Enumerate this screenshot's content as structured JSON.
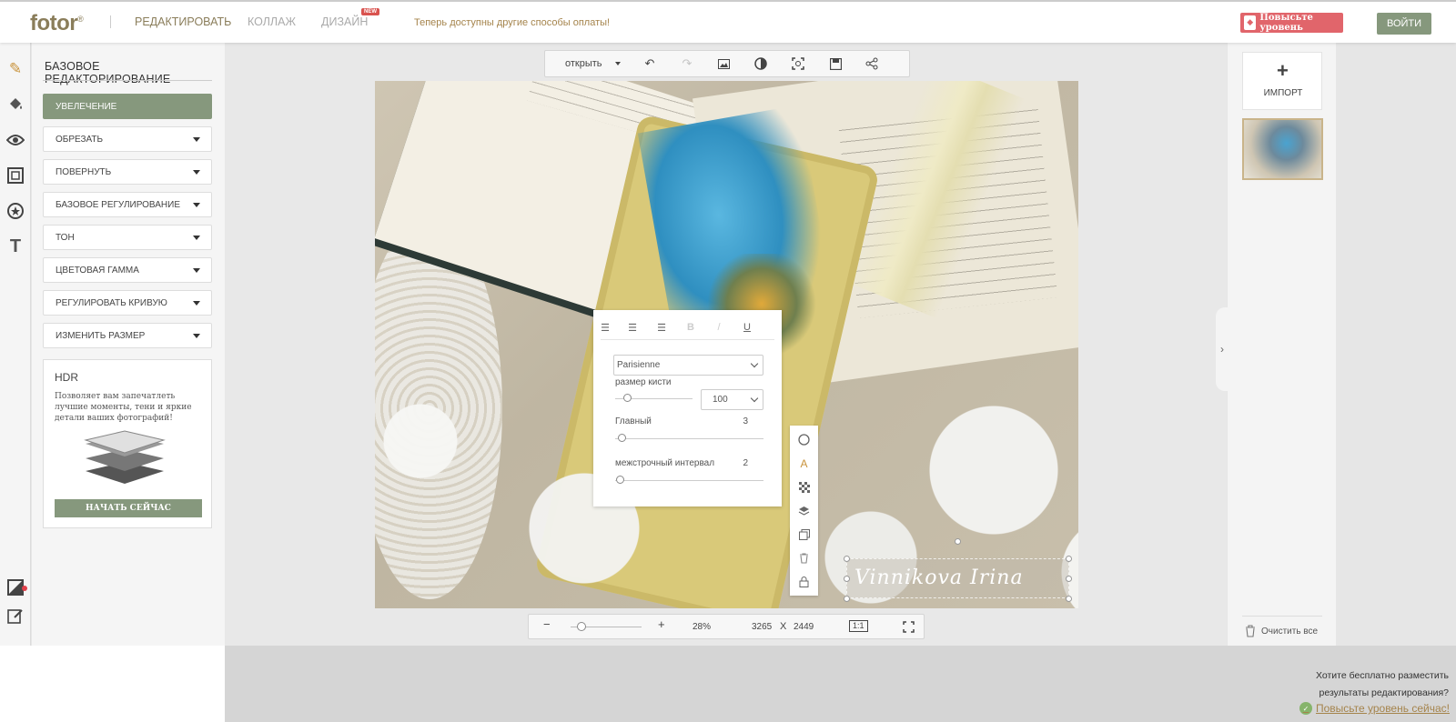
{
  "header": {
    "logo": "fotor",
    "logo_mark": "®",
    "nav": [
      "РЕДАКТИРОВАТЬ",
      "КОЛЛАЖ",
      "ДИЗАЙН"
    ],
    "new_badge": "NEW",
    "promo": "Теперь доступны другие способы оплаты!",
    "upgrade_label": "Повысьте уровень",
    "login_label": "ВОЙТИ",
    "colors": {
      "accent": "#86987d",
      "upgrade": "#e1656b",
      "gold": "#a5844c"
    }
  },
  "rail": {
    "icons": [
      "pencil-icon",
      "paint-bucket-icon",
      "eye-icon",
      "frame-icon",
      "sticker-icon",
      "text-icon"
    ],
    "bottom_icons": [
      "adjust-icon",
      "edit-note-icon"
    ]
  },
  "panel": {
    "title": "БАЗОВОЕ РЕДАКТОРИРОВАНИЕ",
    "items": [
      {
        "label": "УВЕЛЕЧЕНИЕ",
        "active": true
      },
      {
        "label": "ОБРЕЗАТЬ"
      },
      {
        "label": "ПОВЕРНУТЬ"
      },
      {
        "label": "БАЗОВОЕ РЕГУЛИРОВАНИЕ"
      },
      {
        "label": "ТОН"
      },
      {
        "label": "ЦВЕТОВАЯ ГАММА"
      },
      {
        "label": "РЕГУЛИРОВАТЬ КРИВУЮ"
      },
      {
        "label": "ИЗМЕНИТЬ РАЗМЕР"
      }
    ],
    "hdr": {
      "title": "HDR",
      "description": "Позволяет вам запечатлеть лучшие моменты, тени и яркие детали ваших фотографий!",
      "button": "НАЧАТЬ СЕЙЧАС"
    }
  },
  "toolbar": {
    "open_label": "открыть",
    "icons": [
      "undo-icon",
      "redo-icon",
      "image-icon",
      "compare-icon",
      "fit-screen-icon",
      "save-icon",
      "share-icon"
    ]
  },
  "text_settings": {
    "align_icons": [
      "align-left-icon",
      "align-center-icon",
      "align-right-icon",
      "bold-icon",
      "italic-icon",
      "underline-icon"
    ],
    "font": "Parisienne",
    "brush_size_label": "размер кисти",
    "brush_size_value": "100",
    "main_label": "Главный",
    "main_value": "3",
    "line_spacing_label": "межстрочный интервал",
    "line_spacing_value": "2",
    "underline_glyph": "U",
    "bold_glyph": "B",
    "italic_glyph": "/"
  },
  "watermark_text": "Vinnikova Irina",
  "side_tools": [
    "shape-circle-icon",
    "text-color-icon",
    "texture-icon",
    "layers-icon",
    "duplicate-icon",
    "delete-icon",
    "lock-icon"
  ],
  "zoom": {
    "minus": "−",
    "plus": "+",
    "percent": "28%",
    "width": "3265",
    "x": "X",
    "height": "2449",
    "actual_size": "1:1"
  },
  "right_panel": {
    "import_label": "ИМПОРТ",
    "clear_all": "Очистить все"
  },
  "footer_promo": {
    "line1": "Хотите бесплатно разместить",
    "line2": "результаты редактирования?",
    "link": "Повысьте уровень сейчас!"
  }
}
